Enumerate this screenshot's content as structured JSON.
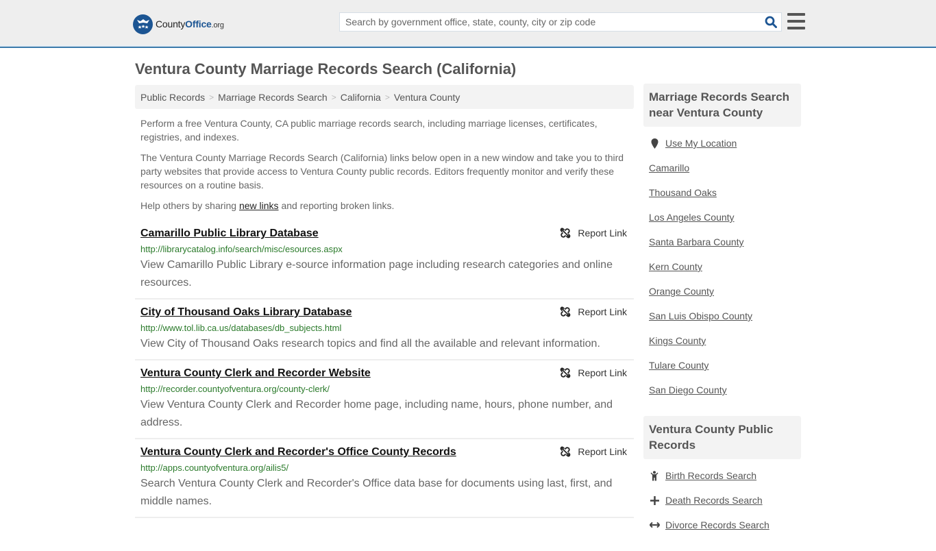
{
  "header": {
    "logo": {
      "brand_part1": "County",
      "brand_part2": "Office",
      "brand_suffix": ".org"
    },
    "search": {
      "placeholder": "Search by government office, state, county, city or zip code",
      "value": ""
    },
    "icons": {
      "search": "search-icon",
      "menu": "hamburger-menu-icon"
    }
  },
  "page": {
    "title": "Ventura County Marriage Records Search (California)",
    "breadcrumb": [
      {
        "label": "Public Records"
      },
      {
        "label": "Marriage Records Search"
      },
      {
        "label": "California"
      },
      {
        "label": "Ventura County"
      }
    ],
    "intro": {
      "p1": "Perform a free Ventura County, CA public marriage records search, including marriage licenses, certificates, registries, and indexes.",
      "p2": "The Ventura County Marriage Records Search (California) links below open in a new window and take you to third party websites that provide access to Ventura County public records. Editors frequently monitor and verify these resources on a routine basis.",
      "p3_before": "Help others by sharing ",
      "p3_link": "new links",
      "p3_after": " and reporting broken links."
    }
  },
  "results": [
    {
      "title": "Camarillo Public Library Database",
      "url": "http://librarycatalog.info/search/misc/esources.aspx",
      "description": "View Camarillo Public Library e-source information page including research categories and online resources.",
      "report_label": "Report Link"
    },
    {
      "title": "City of Thousand Oaks Library Database",
      "url": "http://www.tol.lib.ca.us/databases/db_subjects.html",
      "description": "View City of Thousand Oaks research topics and find all the available and relevant information.",
      "report_label": "Report Link"
    },
    {
      "title": "Ventura County Clerk and Recorder Website",
      "url": "http://recorder.countyofventura.org/county-clerk/",
      "description": "View Ventura County Clerk and Recorder home page, including name, hours, phone number, and address.",
      "report_label": "Report Link"
    },
    {
      "title": "Ventura County Clerk and Recorder's Office County Records",
      "url": "http://apps.countyofventura.org/ailis5/",
      "description": "Search Ventura County Clerk and Recorder's Office data base for documents using last, first, and middle names.",
      "report_label": "Report Link"
    }
  ],
  "sidebar": {
    "nearby": {
      "heading": "Marriage Records Search near Ventura County",
      "use_location": "Use My Location",
      "items": [
        "Camarillo",
        "Thousand Oaks",
        "Los Angeles County",
        "Santa Barbara County",
        "Kern County",
        "Orange County",
        "San Luis Obispo County",
        "Kings County",
        "Tulare County",
        "San Diego County"
      ]
    },
    "public_records": {
      "heading": "Ventura County Public Records",
      "items": [
        {
          "label": "Birth Records Search",
          "icon": "child-icon"
        },
        {
          "label": "Death Records Search",
          "icon": "cross-icon"
        },
        {
          "label": "Divorce Records Search",
          "icon": "arrows-horizontal-icon"
        }
      ]
    }
  }
}
